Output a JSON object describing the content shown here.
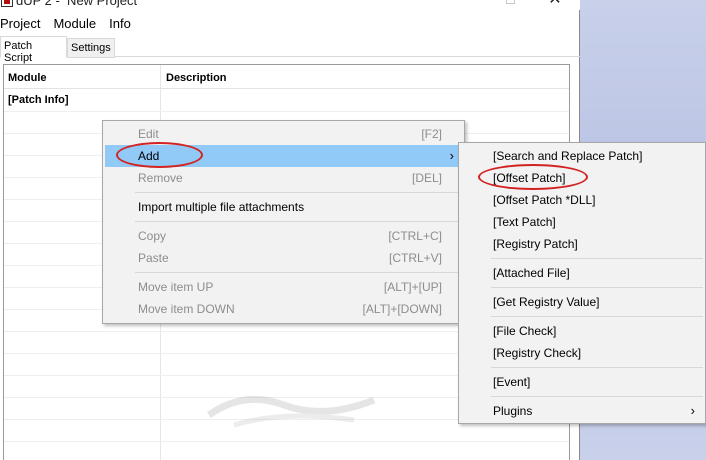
{
  "window": {
    "title": "dUP 2 -  New Project",
    "close_glyph": "✕"
  },
  "menubar": {
    "items": [
      "Project",
      "Module",
      "Info"
    ]
  },
  "tabs": [
    {
      "label": "Patch Script",
      "active": true
    },
    {
      "label": "Settings",
      "active": false
    }
  ],
  "list": {
    "columns": [
      "Module",
      "Description"
    ],
    "rows": [
      {
        "module": "[Patch Info]",
        "description": ""
      }
    ]
  },
  "context_menu": {
    "items": [
      {
        "label": "Edit",
        "shortcut": "[F2]",
        "disabled": true
      },
      {
        "label": "Add",
        "shortcut": "",
        "disabled": false,
        "highlighted": true,
        "has_submenu": true
      },
      {
        "label": "Remove",
        "shortcut": "[DEL]",
        "disabled": true
      },
      {
        "label": "Import multiple file attachments",
        "shortcut": "",
        "disabled": false
      },
      {
        "label": "Copy",
        "shortcut": "[CTRL+C]",
        "disabled": true
      },
      {
        "label": "Paste",
        "shortcut": "[CTRL+V]",
        "disabled": true
      },
      {
        "label": "Move item UP",
        "shortcut": "[ALT]+[UP]",
        "disabled": true
      },
      {
        "label": "Move item DOWN",
        "shortcut": "[ALT]+[DOWN]",
        "disabled": true
      }
    ]
  },
  "add_submenu": {
    "items": [
      {
        "label": "[Search and Replace Patch]"
      },
      {
        "label": "[Offset Patch]",
        "annotated": true
      },
      {
        "label": "[Offset Patch *DLL]"
      },
      {
        "label": "[Text Patch]"
      },
      {
        "label": "[Registry Patch]"
      },
      {
        "label": "[Attached File]"
      },
      {
        "label": "[Get Registry Value]"
      },
      {
        "label": "[File Check]"
      },
      {
        "label": "[Registry Check]"
      },
      {
        "label": "[Event]"
      },
      {
        "label": "Plugins",
        "has_submenu": true
      }
    ]
  },
  "annotation_color": "#d22222",
  "highlight_color": "#91c9f7"
}
